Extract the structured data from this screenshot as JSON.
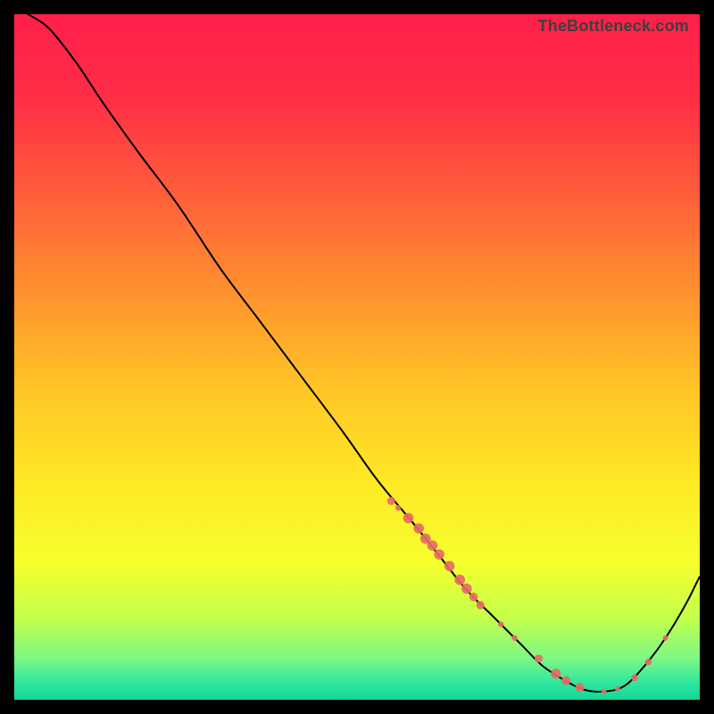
{
  "attribution": "TheBottleneck.com",
  "chart_data": {
    "type": "line",
    "title": "",
    "xlabel": "",
    "ylabel": "",
    "xlim": [
      0,
      100
    ],
    "ylim": [
      0,
      100
    ],
    "grid": false,
    "legend": false,
    "background_gradient_stops": [
      {
        "offset": 0.0,
        "color": "#ff1f4a"
      },
      {
        "offset": 0.12,
        "color": "#ff2d46"
      },
      {
        "offset": 0.25,
        "color": "#ff5a3b"
      },
      {
        "offset": 0.4,
        "color": "#ff8f2f"
      },
      {
        "offset": 0.55,
        "color": "#ffc626"
      },
      {
        "offset": 0.68,
        "color": "#ffe824"
      },
      {
        "offset": 0.8,
        "color": "#f6ff2d"
      },
      {
        "offset": 0.88,
        "color": "#c4ff4a"
      },
      {
        "offset": 0.94,
        "color": "#7cf885"
      },
      {
        "offset": 0.975,
        "color": "#2fe79e"
      },
      {
        "offset": 1.0,
        "color": "#14d79a"
      }
    ],
    "series": [
      {
        "name": "bottleneck-curve",
        "color": "#000000",
        "stroke_width": 2,
        "x": [
          2,
          5,
          9,
          13,
          18,
          24,
          30,
          36,
          42,
          48,
          53,
          58,
          62,
          66,
          70,
          74,
          77,
          80,
          83,
          86,
          89,
          92,
          95,
          98,
          100
        ],
        "values": [
          100,
          98,
          93,
          87,
          80,
          72,
          63,
          55,
          47,
          39,
          32,
          26,
          21,
          16,
          12,
          8,
          5,
          3,
          1.5,
          1.2,
          2,
          5,
          9,
          14,
          18
        ]
      }
    ],
    "markers": {
      "name": "highlight-dots",
      "color": "#e86a66",
      "x": [
        55,
        56,
        57.5,
        59,
        60,
        61,
        62,
        63.5,
        65,
        66,
        67,
        68,
        71,
        73,
        76.5,
        79,
        80.5,
        82.5,
        86,
        88,
        90.5,
        92.5,
        95
      ],
      "values": [
        29,
        28,
        26.5,
        25,
        23.5,
        22.5,
        21.2,
        19.5,
        17.5,
        16.2,
        15,
        13.8,
        11,
        9,
        6,
        3.8,
        2.8,
        1.8,
        1.2,
        1.6,
        3.2,
        5.5,
        9
      ],
      "radius": [
        4.5,
        3.2,
        5.8,
        5.8,
        5.8,
        5.8,
        5.8,
        5.8,
        5.8,
        5.8,
        4.8,
        4.6,
        3.2,
        3.2,
        4.6,
        5.6,
        5.0,
        5.0,
        3.0,
        3.0,
        3.8,
        3.8,
        3.0
      ]
    }
  }
}
